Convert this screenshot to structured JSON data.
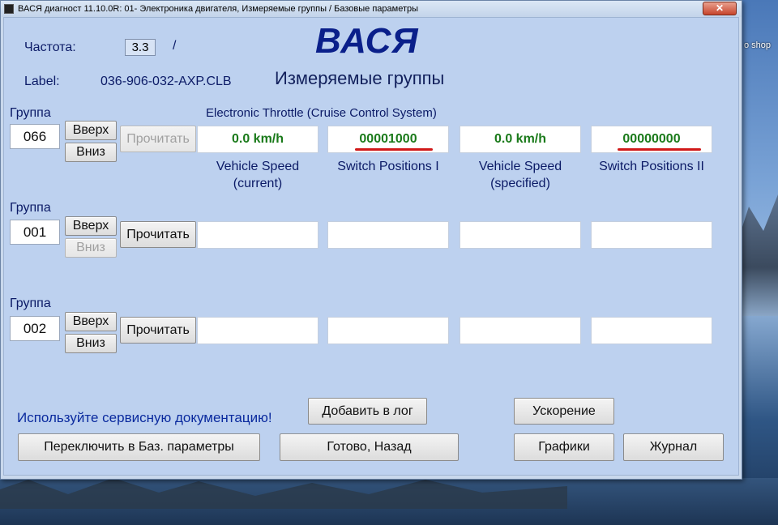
{
  "titlebar": {
    "title": "ВАСЯ диагност 11.10.0R: 01- Электроника двигателя,  Измеряемые группы / Базовые параметры",
    "close_symbol": "✕"
  },
  "desktop": {
    "icon_label": "o shop"
  },
  "header": {
    "frequency_label": "Частота:",
    "frequency_value": "3.3",
    "frequency_separator": "/",
    "label_label": "Label:",
    "label_value": "036-906-032-AXP.CLB",
    "logo": "ВАСЯ",
    "subtitle": "Измеряемые группы",
    "system_name": "Electronic Throttle (Cruise Control System)"
  },
  "groups": [
    {
      "label": "Группа",
      "number": "066",
      "up_label": "Вверх",
      "down_label": "Вниз",
      "read_label": "Прочитать",
      "read_enabled": false,
      "down_enabled": true,
      "values": [
        "0.0 km/h",
        "00001000",
        "0.0 km/h",
        "00000000"
      ],
      "labels": [
        [
          "Vehicle Speed",
          "(current)"
        ],
        [
          "Switch Positions I",
          ""
        ],
        [
          "Vehicle Speed",
          "(specified)"
        ],
        [
          "Switch Positions II",
          ""
        ]
      ]
    },
    {
      "label": "Группа",
      "number": "001",
      "up_label": "Вверх",
      "down_label": "Вниз",
      "read_label": "Прочитать",
      "read_enabled": true,
      "down_enabled": false,
      "values": [
        "",
        "",
        "",
        ""
      ]
    },
    {
      "label": "Группа",
      "number": "002",
      "up_label": "Вверх",
      "down_label": "Вниз",
      "read_label": "Прочитать",
      "read_enabled": true,
      "down_enabled": true,
      "values": [
        "",
        "",
        "",
        ""
      ]
    }
  ],
  "footer": {
    "hint": "Используйте сервисную документацию!",
    "add_log_label": "Добавить в лог",
    "acceleration_label": "Ускорение",
    "switch_basic_label": "Переключить в Баз. параметры",
    "done_back_label": "Готово, Назад",
    "graphs_label": "Графики",
    "journal_label": "Журнал"
  },
  "colors": {
    "value_text": "#1a7a1a",
    "annotation_underline": "#d01818",
    "label_text": "#0b1a66",
    "logo": "#0a1f8a"
  }
}
